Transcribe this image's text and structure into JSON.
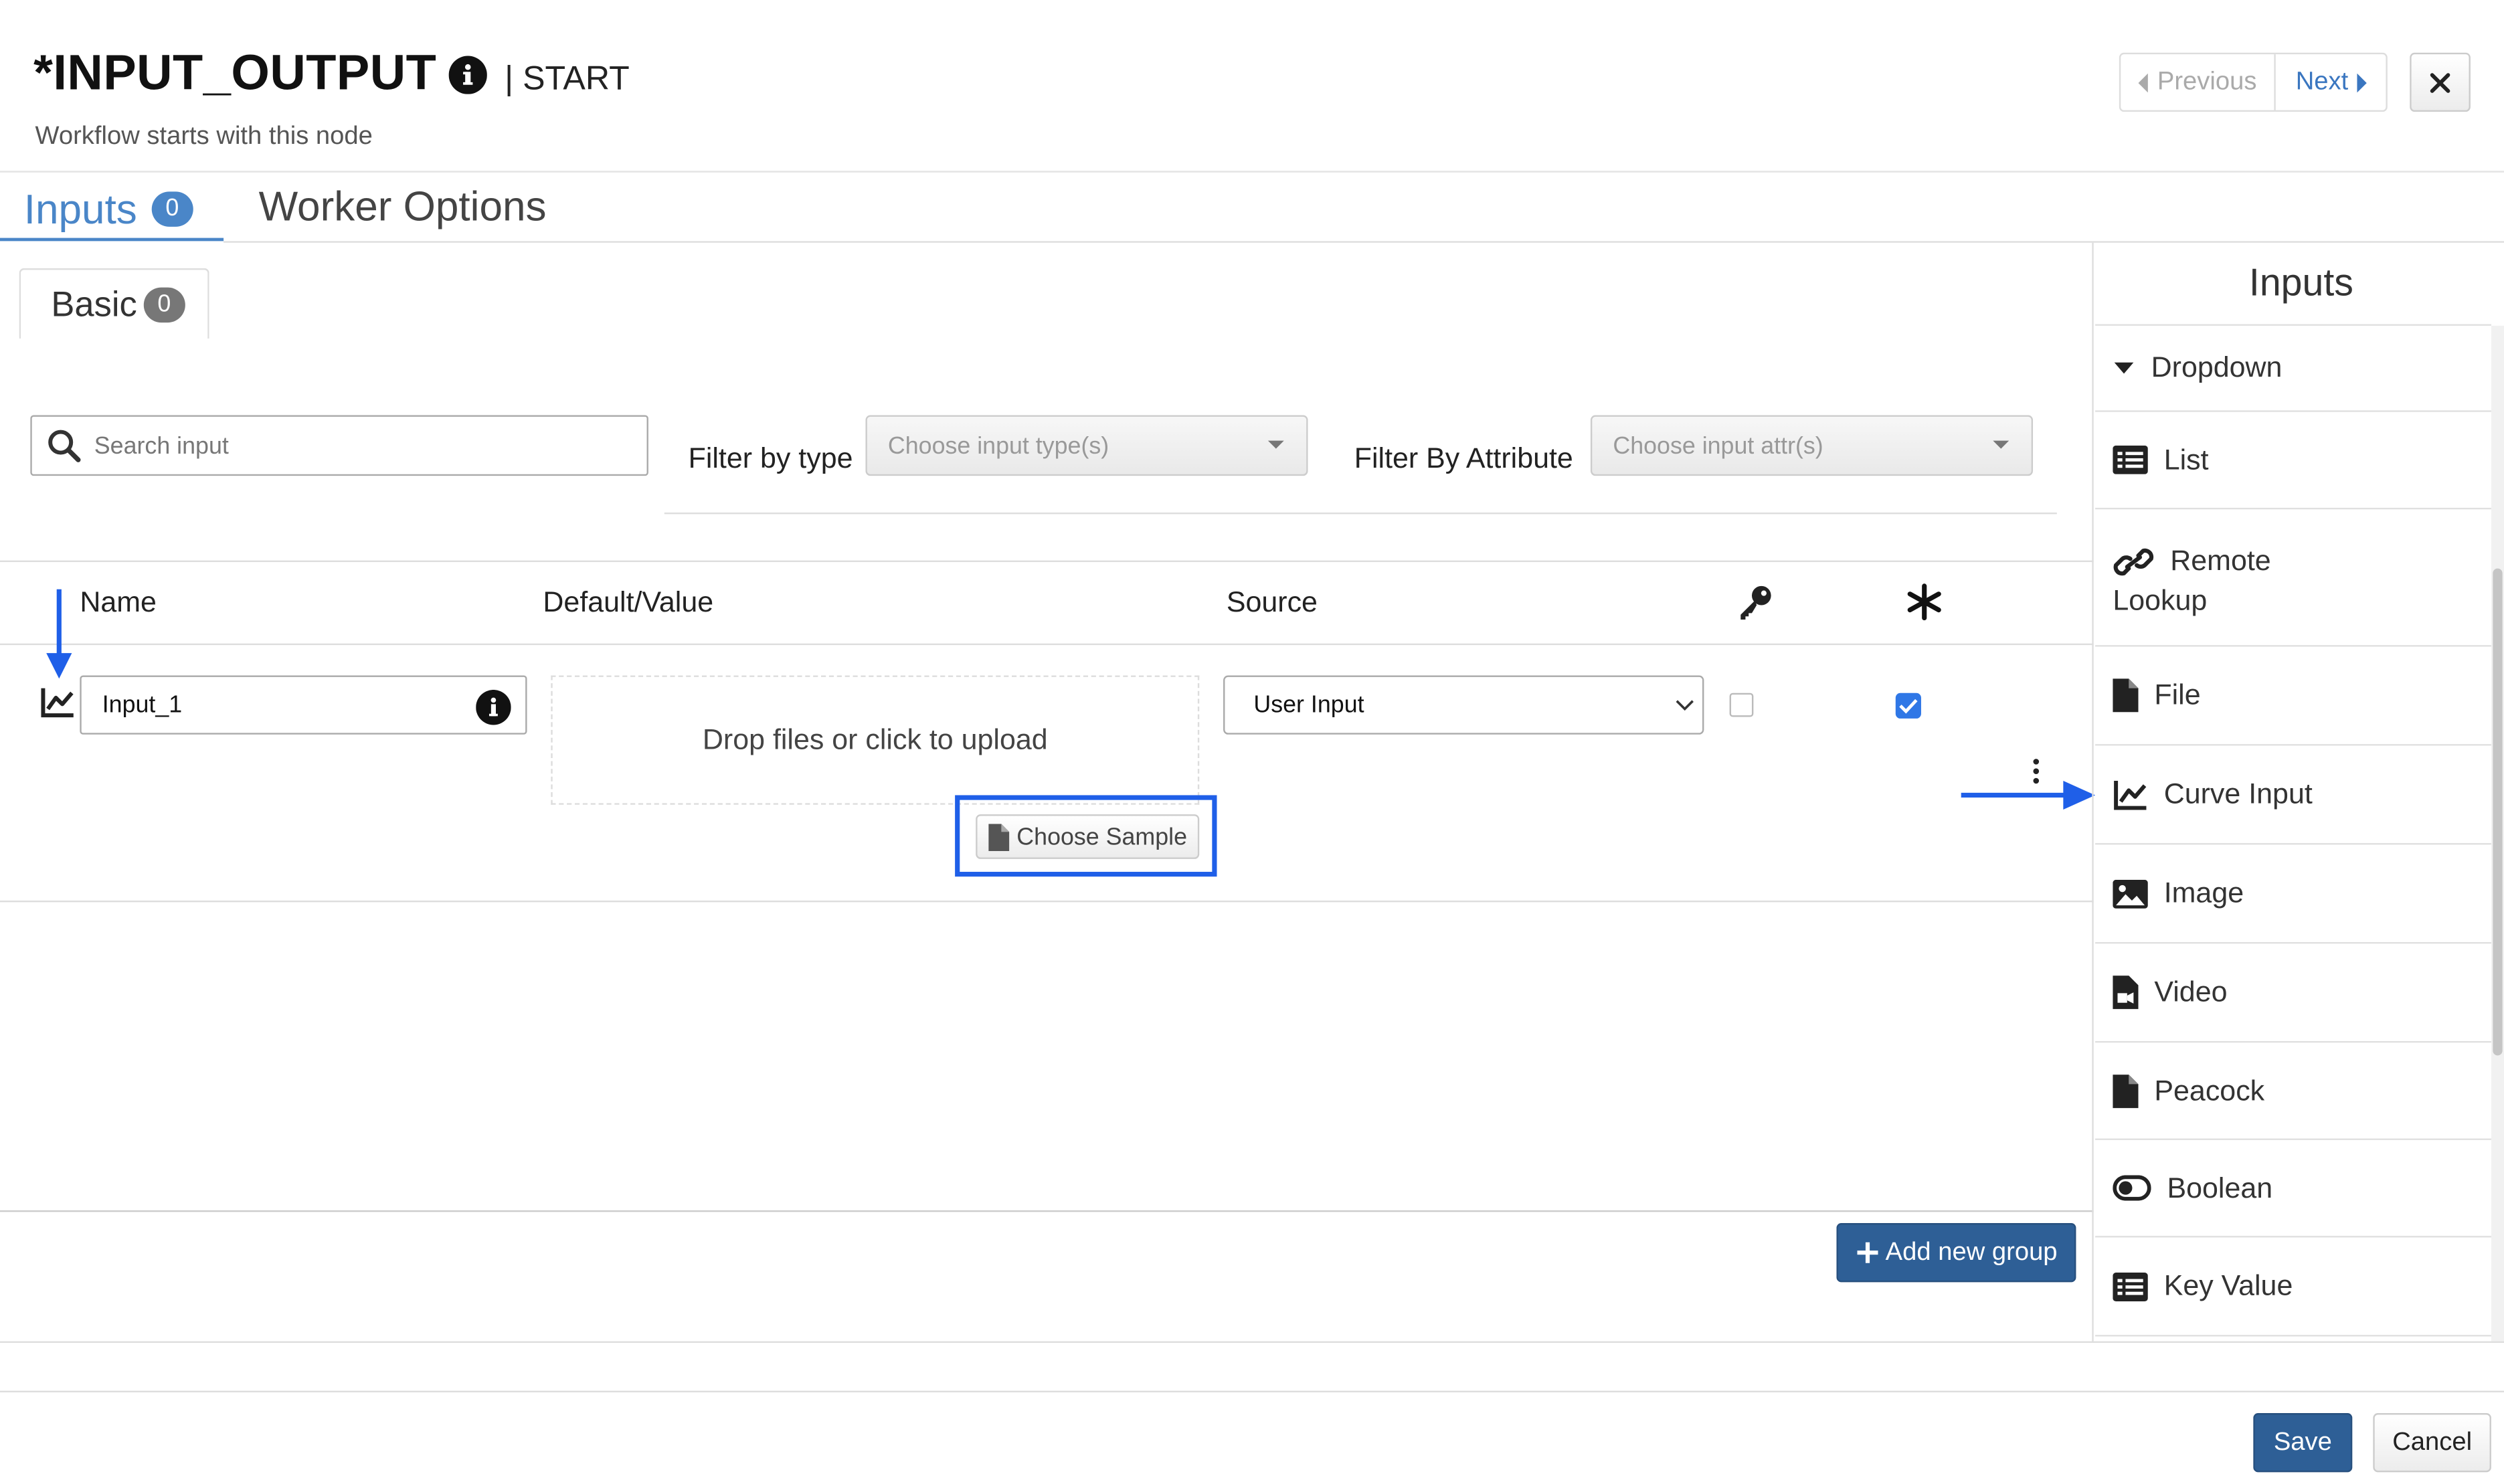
{
  "header": {
    "title": "*INPUT_OUTPUT",
    "node_type": "| START",
    "subtitle": "Workflow starts with this node",
    "previous_label": "Previous",
    "next_label": "Next"
  },
  "tabs": [
    {
      "label": "Inputs",
      "badge": "0",
      "active": true
    },
    {
      "label": "Worker Options",
      "active": false
    }
  ],
  "subtab": {
    "label": "Basic",
    "badge": "0"
  },
  "filters": {
    "search_placeholder": "Search input",
    "type_label": "Filter by type",
    "type_placeholder": "Choose input type(s)",
    "attr_label": "Filter By Attribute",
    "attr_placeholder": "Choose input attr(s)"
  },
  "table": {
    "columns": [
      "Name",
      "Default/Value",
      "Source"
    ],
    "rows": [
      {
        "name": "Input_1",
        "upload_text": "Drop files or click to upload",
        "choose_sample": "Choose Sample",
        "source": "User Input",
        "key_checked": false,
        "required_checked": true
      }
    ]
  },
  "add_group_label": "Add new group",
  "palette": {
    "title": "Inputs",
    "items": [
      {
        "label": "Dropdown",
        "icon": "caret-down-icon"
      },
      {
        "label": "List",
        "icon": "list-icon"
      },
      {
        "label": "Remote",
        "label2": "Lookup",
        "icon": "link-icon"
      },
      {
        "label": "File",
        "icon": "file-icon"
      },
      {
        "label": "Curve Input",
        "icon": "chart-line-icon"
      },
      {
        "label": "Image",
        "icon": "image-icon"
      },
      {
        "label": "Video",
        "icon": "video-file-icon"
      },
      {
        "label": "Peacock",
        "icon": "file-icon"
      },
      {
        "label": "Boolean",
        "icon": "toggle-icon"
      },
      {
        "label": "Key Value",
        "icon": "list-icon"
      }
    ]
  },
  "footer": {
    "save_label": "Save",
    "cancel_label": "Cancel"
  },
  "colors": {
    "accent": "#4a86c8",
    "primary_button": "#2e5f96",
    "annotation": "#1f5fe8"
  }
}
